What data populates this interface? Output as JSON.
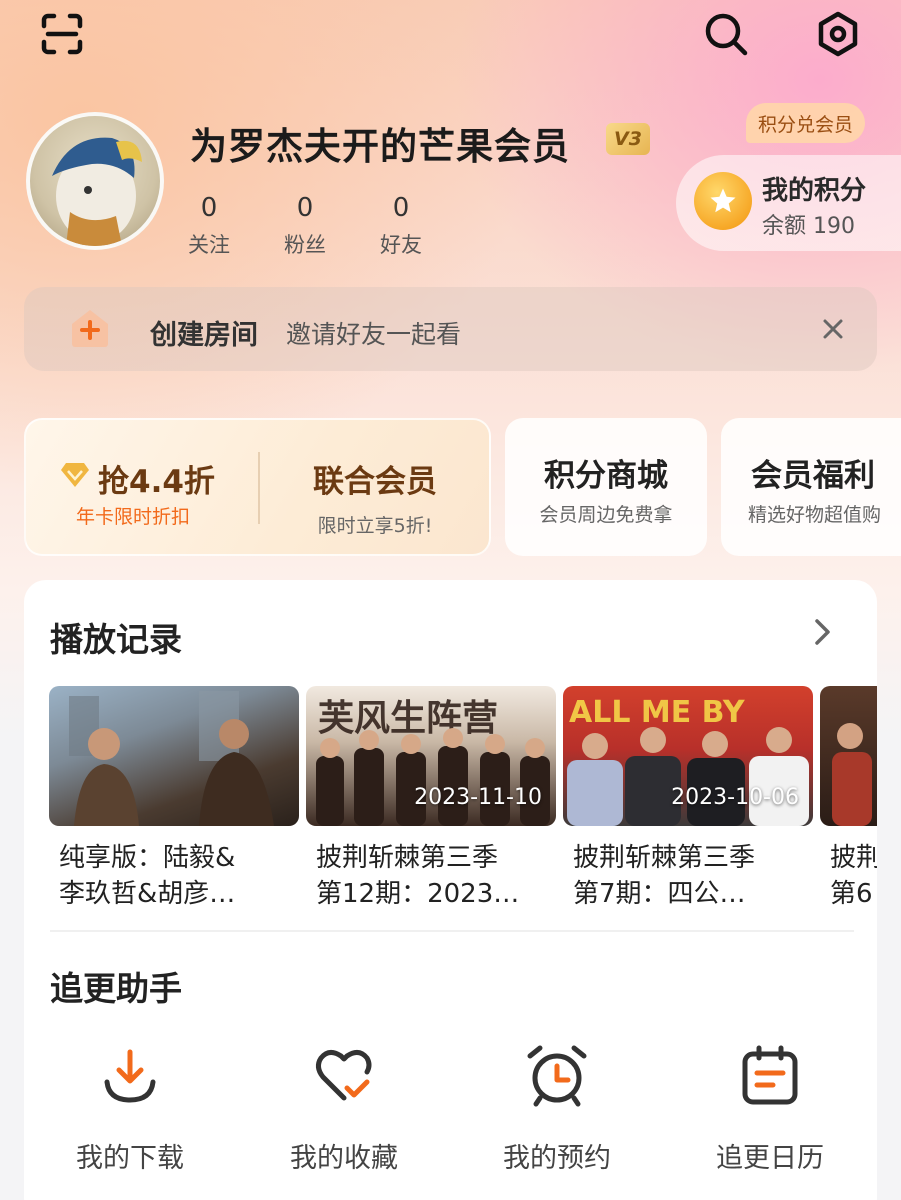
{
  "header": {
    "scan_icon": "scan-icon",
    "search_icon": "search-icon",
    "settings_icon": "settings-icon"
  },
  "profile": {
    "username": "为罗杰夫开的芒果会员",
    "vip_level": "V3",
    "stats": [
      {
        "value": "0",
        "label": "关注"
      },
      {
        "value": "0",
        "label": "粉丝"
      },
      {
        "value": "0",
        "label": "好友"
      }
    ]
  },
  "points": {
    "tag": "积分兑会员",
    "title": "我的积分",
    "balance": "余额 190"
  },
  "room": {
    "title": "创建房间",
    "subtitle": "邀请好友一起看"
  },
  "promos": {
    "deal": {
      "title": "抢4.4折",
      "sub": "年卡限时折扣"
    },
    "joint": {
      "title": "联合会员",
      "sub": "限时立享5折!"
    },
    "mall": {
      "title": "积分商城",
      "sub": "会员周边免费拿"
    },
    "welfare": {
      "title": "会员福利",
      "sub": "精选好物超值购"
    }
  },
  "history": {
    "title": "播放记录",
    "items": [
      {
        "line1": "纯享版：陆毅&",
        "line2": "李玖哲&胡彦…",
        "date": ""
      },
      {
        "line1": "披荆斩棘第三季",
        "line2": "第12期：2023…",
        "date": "2023-11-10"
      },
      {
        "line1": "披荆斩棘第三季",
        "line2": "第7期：四公…",
        "date": "2023-10-06"
      },
      {
        "line1": "披荆",
        "line2": "第6",
        "date": ""
      }
    ]
  },
  "assistant": {
    "title": "追更助手",
    "tools": [
      {
        "label": "我的下载",
        "icon": "download-icon"
      },
      {
        "label": "我的收藏",
        "icon": "favorite-heart-icon"
      },
      {
        "label": "我的预约",
        "icon": "alarm-clock-icon"
      },
      {
        "label": "追更日历",
        "icon": "calendar-icon"
      }
    ]
  },
  "colors": {
    "accent": "#f26a1b",
    "gold": "#e7b552"
  }
}
